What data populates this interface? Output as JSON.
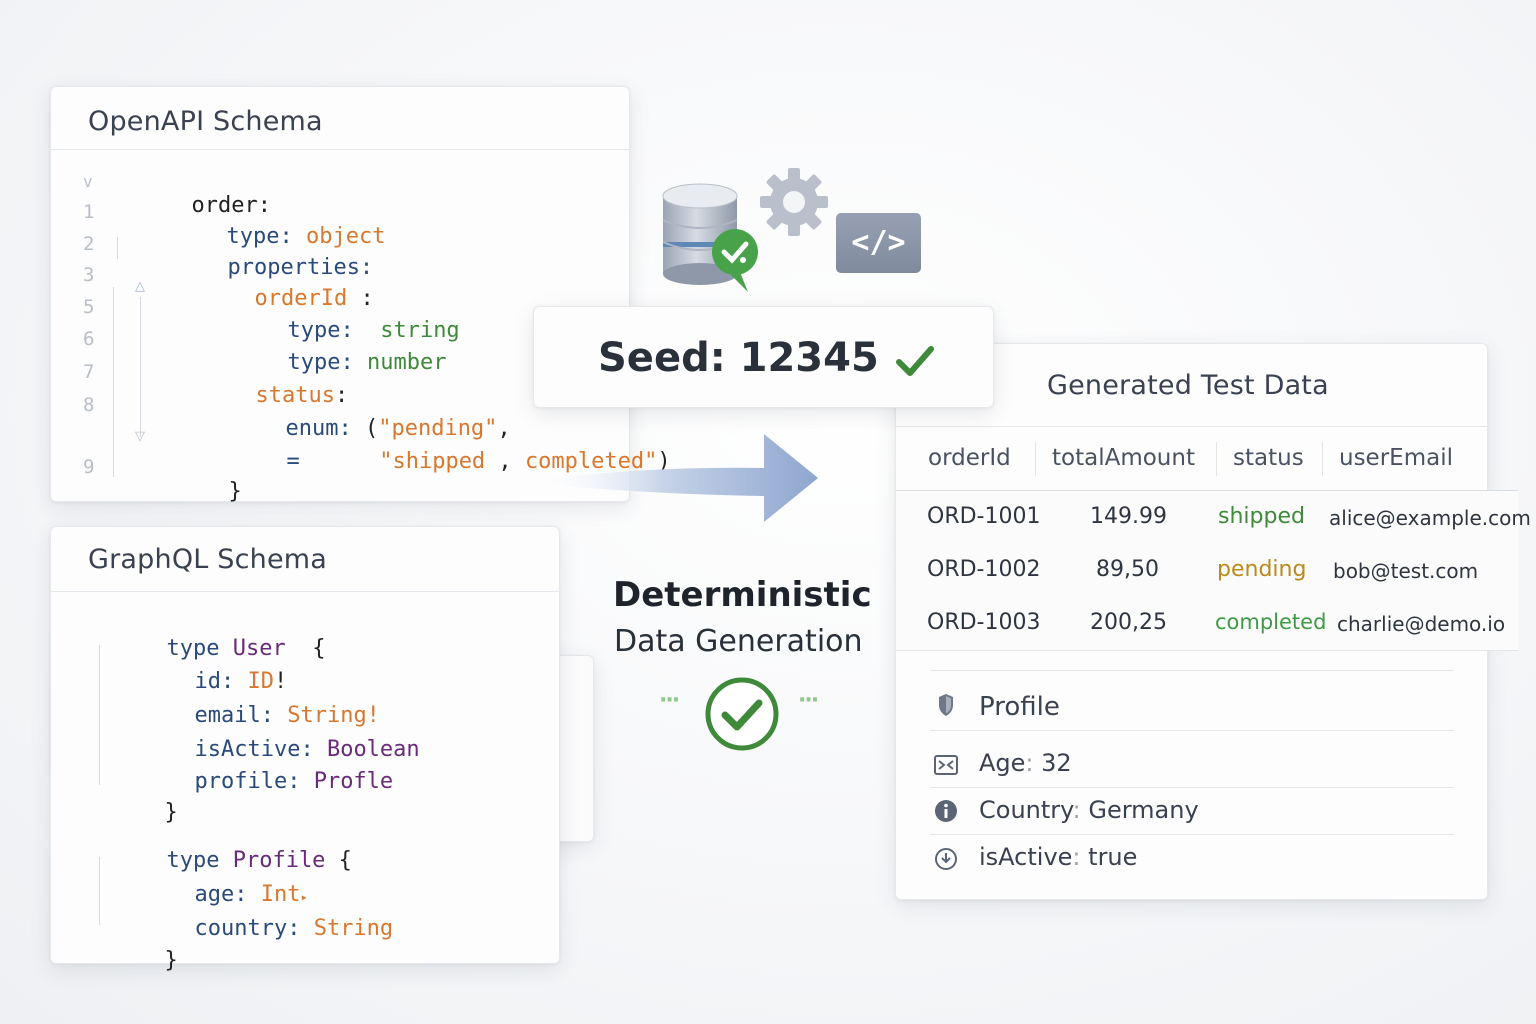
{
  "openapi": {
    "title": "OpenAPI Schema",
    "fold_marker": "v",
    "line_numbers": [
      "1",
      "2",
      "3",
      "5",
      "6",
      "7",
      "8",
      "9"
    ],
    "lines": [
      {
        "parts": [
          "order:"
        ]
      },
      {
        "parts": [
          "type:",
          " object"
        ]
      },
      {
        "parts": [
          "properties:"
        ]
      },
      {
        "parts": [
          "orderId",
          " :"
        ]
      },
      {
        "parts": [
          "type:",
          "  string"
        ]
      },
      {
        "parts": [
          "type:",
          " number"
        ]
      },
      {
        "parts": [
          "status",
          ":"
        ]
      },
      {
        "parts": [
          "enum:",
          " (",
          "\"pending\"",
          ","
        ]
      },
      {
        "parts": [
          "=",
          "      ",
          "\"shipped",
          " , ",
          "completed\"",
          ")"
        ]
      },
      {
        "parts": [
          "}"
        ]
      }
    ]
  },
  "graphql": {
    "title": "GraphQL Schema",
    "lines": [
      {
        "parts": [
          "type",
          " User",
          "  {"
        ]
      },
      {
        "parts": [
          "id:",
          " ID",
          "!"
        ]
      },
      {
        "parts": [
          "email:",
          " String!"
        ]
      },
      {
        "parts": [
          "isActive:",
          " Boolean"
        ]
      },
      {
        "parts": [
          "profile:",
          " Profle"
        ]
      },
      {
        "parts": [
          "}"
        ]
      },
      {
        "parts": [
          "type",
          " Profile",
          " {"
        ]
      },
      {
        "parts": [
          "age:",
          " Int",
          "▸"
        ]
      },
      {
        "parts": [
          "country:",
          " String"
        ]
      },
      {
        "parts": [
          "}"
        ]
      }
    ]
  },
  "seed": {
    "label": "Seed: 12345"
  },
  "center": {
    "title": "Deterministic",
    "subtitle": "Data Generation",
    "dots": "···"
  },
  "generated": {
    "title": "Generated Test Data",
    "columns": [
      "orderId",
      "totalAmount",
      "status",
      "userEmail"
    ],
    "rows": [
      {
        "orderId": "ORD-1001",
        "totalAmount": "149.99",
        "status": "shipped",
        "userEmail": "alice@example.com"
      },
      {
        "orderId": "ORD-1002",
        "totalAmount": "89,50",
        "status": "pending",
        "userEmail": "bob@test.com"
      },
      {
        "orderId": "ORD-1003",
        "totalAmount": "200,25",
        "status": "completed",
        "userEmail": "charlie@demo.io"
      }
    ],
    "profile": {
      "heading": "Profile",
      "fields": [
        {
          "label": "Age",
          "sep": ":",
          "value": "32"
        },
        {
          "label": "Country",
          "sep": ":",
          "value": "Germany"
        },
        {
          "label": "isActive",
          "sep": ":",
          "value": "true"
        }
      ]
    }
  },
  "icons": {
    "database": "database-icon",
    "gear": "gear-icon",
    "code": "code-icon",
    "code_text": "</>",
    "check": "check-icon"
  },
  "colors": {
    "accent_green": "#3f8a3a",
    "arrow_blue": "#8ea6cf",
    "code_badge": "#8a95a8"
  }
}
